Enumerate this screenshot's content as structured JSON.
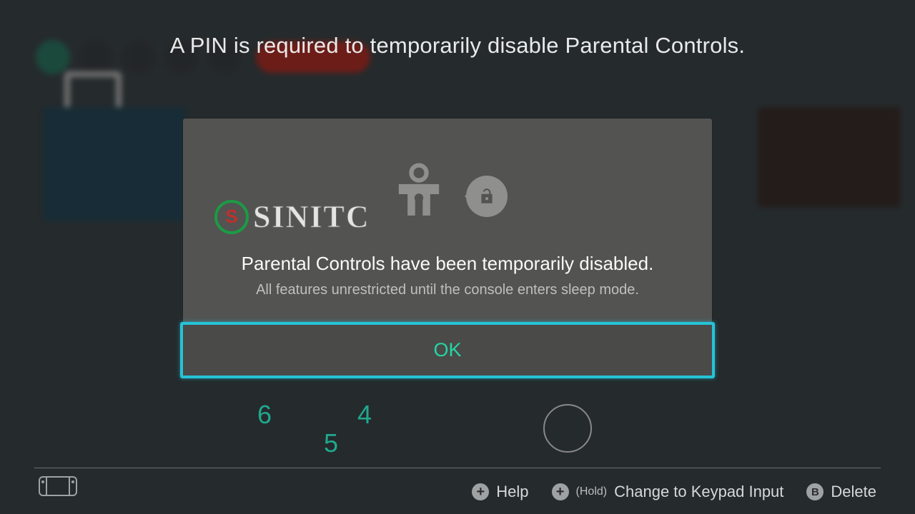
{
  "screen": {
    "title": "A PIN is required to temporarily disable Parental Controls."
  },
  "dialog": {
    "heading": "Parental Controls have been temporarily disabled.",
    "subtext": "All features unrestricted until the console enters sleep mode.",
    "ok_label": "OK"
  },
  "wheel": {
    "left": "6",
    "left_below": "5",
    "right": "4"
  },
  "watermark": {
    "badge": "S",
    "text": "SINITC"
  },
  "hints": {
    "help": {
      "glyph": "+",
      "label": "Help"
    },
    "keypad": {
      "glyph": "+",
      "prefix": "(Hold)",
      "label": "Change to Keypad Input"
    },
    "delete": {
      "glyph": "B",
      "label": "Delete"
    }
  }
}
